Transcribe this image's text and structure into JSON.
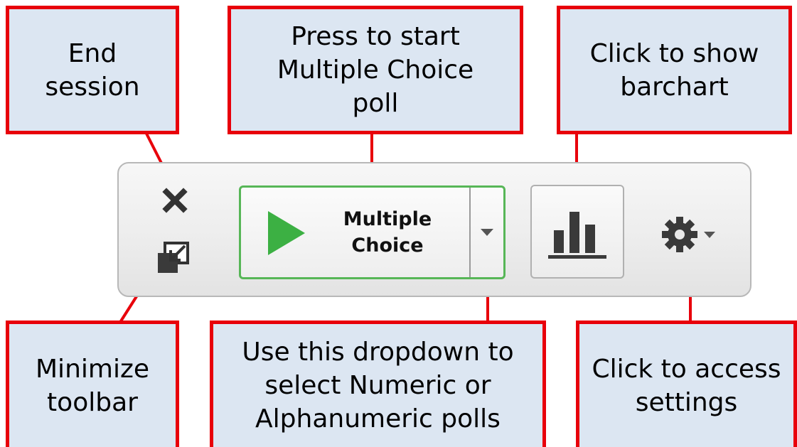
{
  "callouts": {
    "end_session": "End\nsession",
    "start_poll": "Press to start\nMultiple Choice\npoll",
    "show_barchart": "Click to show\nbarchart",
    "minimize_toolbar": "Minimize\ntoolbar",
    "dropdown": "Use this dropdown to\nselect Numeric or\nAlphanumeric polls",
    "settings": "Click to access\nsettings"
  },
  "toolbar": {
    "poll_button_label": "Multiple\nChoice",
    "icons": {
      "close": "close-icon",
      "minimize": "minimize-icon",
      "play": "play-icon",
      "dropdown": "chevron-down-icon",
      "barchart": "bar-chart-icon",
      "settings": "gear-icon"
    }
  },
  "colors": {
    "callout_fill": "#dce6f2",
    "callout_border": "#e8000b",
    "play_green": "#3cb043",
    "poll_border": "#57b657"
  }
}
